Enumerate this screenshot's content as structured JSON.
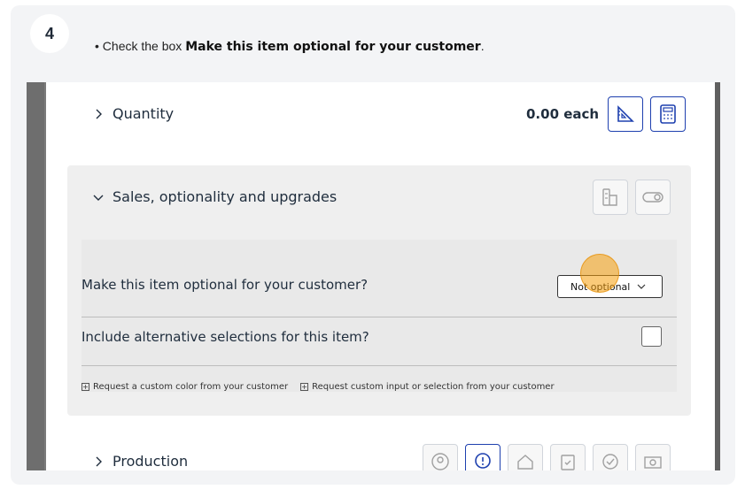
{
  "step": {
    "number": "4",
    "instruction_prefix": "• Check the box ",
    "instruction_bold": "Make this item optional for your customer",
    "instruction_suffix": "."
  },
  "quantity": {
    "label": "Quantity",
    "value": "0.00 each",
    "icons": [
      "ruler-triangle-icon",
      "calculator-icon"
    ]
  },
  "sales_section": {
    "label": "Sales, optionality and upgrades",
    "icons": [
      "palette-swatch-icon",
      "toggle-icon"
    ],
    "optional_question": "Make this item optional for your customer?",
    "optional_select_value": "Not optional",
    "alternatives_question": "Include alternative selections for this item?",
    "link_custom_color": "Request a custom color from your customer",
    "link_custom_input": "Request custom input or selection from your customer"
  },
  "production": {
    "label": "Production",
    "icons": [
      "person-icon",
      "message-alert-icon",
      "home-check-icon",
      "clipboard-check-icon",
      "circle-check-icon",
      "cash-icon"
    ]
  },
  "colors": {
    "accent": "#1e40af",
    "highlight": "#f59e0b"
  }
}
